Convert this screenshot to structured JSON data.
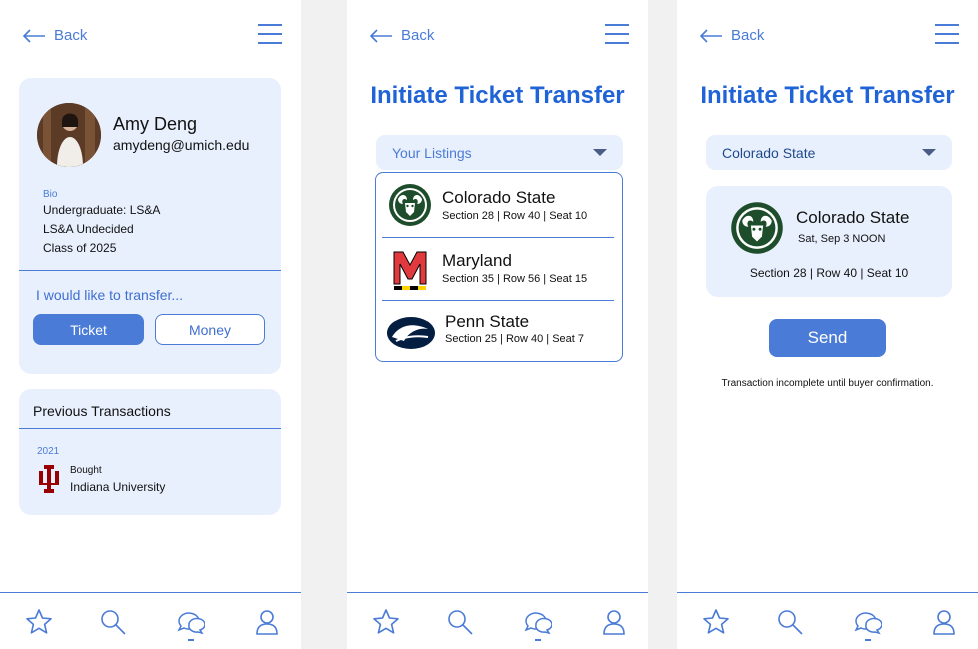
{
  "colors": {
    "accent": "#4a7bd6",
    "title": "#1f63d6",
    "card": "#e9f0fd"
  },
  "common": {
    "back_label": "Back",
    "nav_icons": [
      "star-icon",
      "search-icon",
      "chat-icon",
      "profile-icon"
    ]
  },
  "profile": {
    "name": "Amy Deng",
    "email": "amydeng@umich.edu",
    "bio_label": "Bio",
    "bio_lines": [
      "Undergraduate: LS&A",
      "LS&A Undecided",
      "Class of 2025"
    ],
    "transfer_prompt": "I would like to transfer...",
    "ticket_button": "Ticket",
    "money_button": "Money"
  },
  "transactions": {
    "heading": "Previous Transactions",
    "items": [
      {
        "year": "2021",
        "action": "Bought",
        "school": "Indiana University"
      }
    ]
  },
  "transfer": {
    "title": "Initiate Ticket Transfer",
    "dropdown_placeholder": "Your Listings",
    "listings": [
      {
        "team": "Colorado State",
        "seat": "Section 28 | Row 40 | Seat 10"
      },
      {
        "team": "Maryland",
        "seat": "Section 35 | Row 56 | Seat 15"
      },
      {
        "team": "Penn State",
        "seat": "Section 25 | Row 40 | Seat 7"
      }
    ]
  },
  "confirm": {
    "title": "Initiate Ticket Transfer",
    "selected": "Colorado State",
    "team": "Colorado State",
    "date": "Sat, Sep 3 NOON",
    "seat": "Section 28 | Row 40 | Seat 10",
    "send_label": "Send",
    "note": "Transaction incomplete until buyer confirmation."
  }
}
